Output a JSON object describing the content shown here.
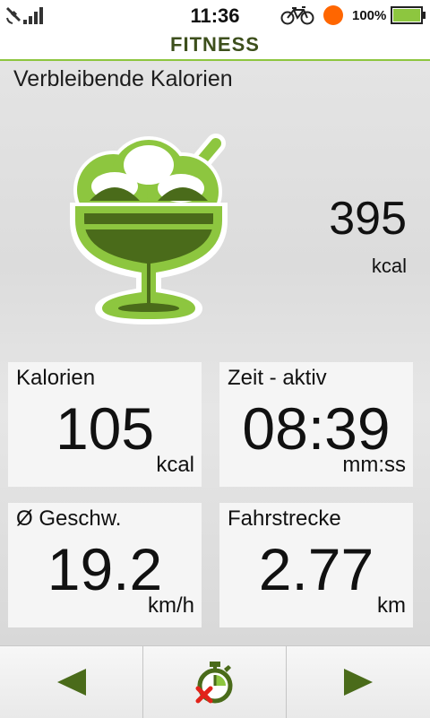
{
  "status_bar": {
    "time": "11:36",
    "battery_percent": "100%",
    "icons": [
      "gps-satellite-icon",
      "signal-bars-icon",
      "bicycle-icon",
      "record-dot-icon",
      "battery-icon"
    ],
    "record_color": "#ff6600",
    "battery_color": "#8dc63f"
  },
  "app": {
    "title": "FITNESS"
  },
  "summary": {
    "heading": "Verbleibende Kalorien",
    "value": "395",
    "unit": "kcal",
    "illustration": "ice-cream-sundae-icon"
  },
  "tiles": [
    {
      "label": "Kalorien",
      "value": "105",
      "unit": "kcal"
    },
    {
      "label": "Zeit - aktiv",
      "value": "08:39",
      "unit": "mm:ss"
    },
    {
      "label": "Ø Geschw.",
      "value": "19.2",
      "unit": "km/h"
    },
    {
      "label": "Fahrstrecke",
      "value": "2.77",
      "unit": "km"
    }
  ],
  "nav": {
    "buttons": [
      "previous-arrow-icon",
      "stopwatch-cancel-icon",
      "next-arrow-icon"
    ],
    "accent_color": "#4a6b1a",
    "cancel_color": "#e2231a"
  },
  "theme": {
    "accent": "#8dc63f",
    "dark_green": "#4a6b1a"
  }
}
